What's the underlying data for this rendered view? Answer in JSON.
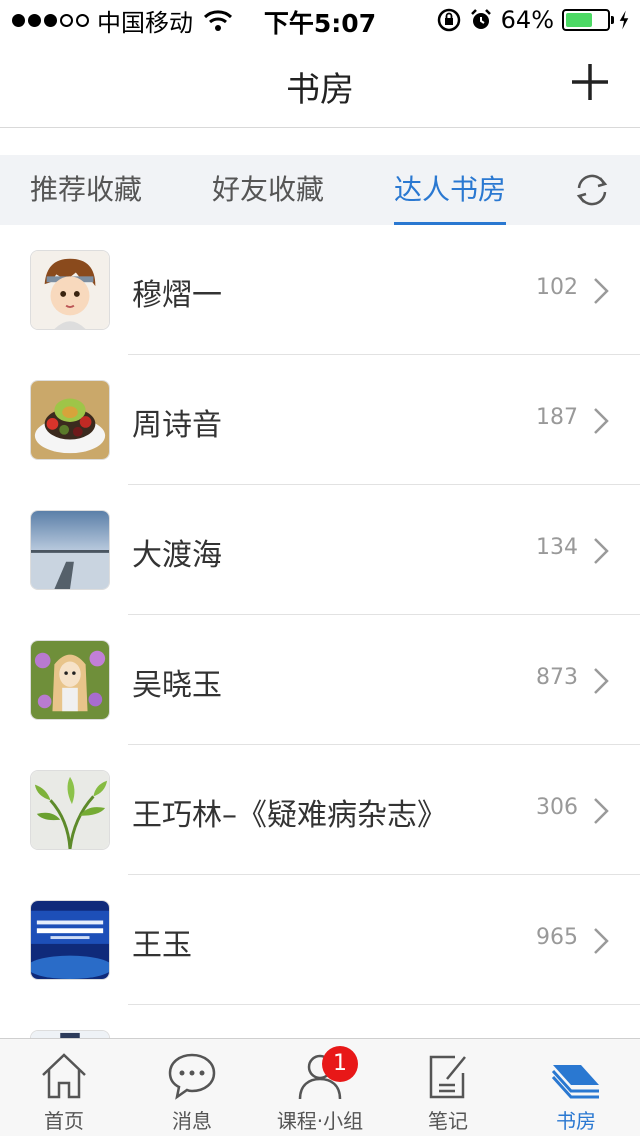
{
  "status_bar": {
    "carrier": "中国移动",
    "time": "下午5:07",
    "battery": "64%",
    "battery_level": 0.64
  },
  "nav": {
    "title": "书房",
    "add_icon": "plus-icon"
  },
  "tabs": [
    {
      "label": "推荐收藏",
      "active": false
    },
    {
      "label": "好友收藏",
      "active": false
    },
    {
      "label": "达人书房",
      "active": true
    }
  ],
  "refresh_icon": "refresh-icon",
  "list": [
    {
      "name": "穆熠一",
      "count": "102"
    },
    {
      "name": "周诗音",
      "count": "187"
    },
    {
      "name": "大渡海",
      "count": "134"
    },
    {
      "name": "吴晓玉",
      "count": "873"
    },
    {
      "name": "王巧林–《疑难病杂志》",
      "count": "306"
    },
    {
      "name": "王玉",
      "count": "965"
    }
  ],
  "tab_bar": {
    "items": [
      {
        "label": "首页",
        "icon": "home-icon",
        "active": false
      },
      {
        "label": "消息",
        "icon": "message-icon",
        "active": false
      },
      {
        "label": "课程·小组",
        "icon": "person-icon",
        "active": false,
        "badge": "1"
      },
      {
        "label": "笔记",
        "icon": "note-icon",
        "active": false
      },
      {
        "label": "书房",
        "icon": "books-icon",
        "active": true
      }
    ]
  },
  "colors": {
    "accent": "#2a78d1",
    "badge": "#e81818",
    "battery": "#4cd964"
  }
}
